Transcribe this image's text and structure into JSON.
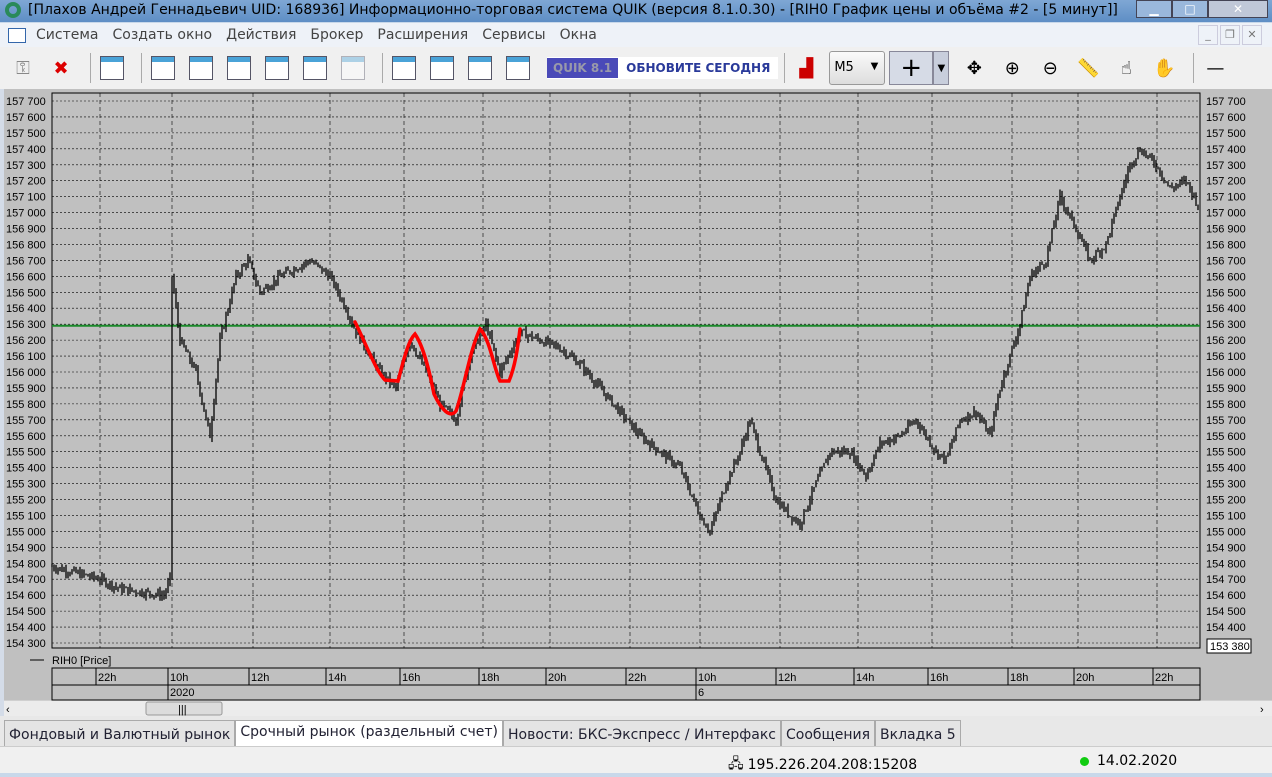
{
  "window": {
    "title": "[Плахов Андрей Геннадьевич UID: 168936] Информационно-торговая система QUIK (версия 8.1.0.30) - [RIH0 График цены и объёма #2 - [5 минут]]"
  },
  "menu": [
    "Система",
    "Создать окно",
    "Действия",
    "Брокер",
    "Расширения",
    "Сервисы",
    "Окна"
  ],
  "toolbar": {
    "quik_version": "QUIK 8.1",
    "update_banner": "ОБНОВИТЕ СЕГОДНЯ",
    "interval": "M5"
  },
  "chart": {
    "legend": "RIH0 [Price]",
    "last_value": "153 380",
    "colors": {
      "price": "#000000",
      "level": "#1a8a2a",
      "drawing": "#ff0000",
      "bg": "#c0c0c0"
    }
  },
  "chart_data": {
    "type": "line",
    "instrument": "RIH0",
    "interval": "5 минут",
    "ylim": [
      154300,
      157700
    ],
    "yticks": [
      "157 700",
      "157 600",
      "157 500",
      "157 400",
      "157 300",
      "157 200",
      "157 100",
      "157 000",
      "156 900",
      "156 800",
      "156 700",
      "156 600",
      "156 500",
      "156 400",
      "156 300",
      "156 200",
      "156 100",
      "156 000",
      "155 900",
      "155 800",
      "155 700",
      "155 600",
      "155 500",
      "155 400",
      "155 300",
      "155 200",
      "155 100",
      "155 000",
      "154 900",
      "154 800",
      "154 700",
      "154 600",
      "154 500",
      "154 400",
      "154 300"
    ],
    "xticks": [
      "22h",
      "10h",
      "12h",
      "14h",
      "16h",
      "18h",
      "20h",
      "22h",
      "10h",
      "12h",
      "14h",
      "16h",
      "18h",
      "20h",
      "22h"
    ],
    "xticks_row2": [
      "2020",
      "6"
    ],
    "level_line": 156290,
    "points": [
      [
        0,
        154780
      ],
      [
        24,
        154700
      ],
      [
        34,
        154640
      ],
      [
        56,
        154600
      ],
      [
        59,
        154700
      ],
      [
        60,
        156600
      ],
      [
        64,
        156200
      ],
      [
        72,
        156000
      ],
      [
        77,
        155700
      ],
      [
        79,
        155600
      ],
      [
        84,
        156200
      ],
      [
        92,
        156600
      ],
      [
        98,
        156700
      ],
      [
        104,
        156500
      ],
      [
        114,
        156600
      ],
      [
        129,
        156700
      ],
      [
        139,
        156600
      ],
      [
        147,
        156400
      ],
      [
        152,
        156250
      ],
      [
        164,
        156000
      ],
      [
        172,
        155900
      ],
      [
        179,
        156200
      ],
      [
        187,
        156000
      ],
      [
        194,
        155800
      ],
      [
        202,
        155700
      ],
      [
        209,
        156100
      ],
      [
        217,
        156300
      ],
      [
        224,
        156000
      ],
      [
        234,
        156250
      ],
      [
        244,
        156200
      ],
      [
        254,
        156150
      ],
      [
        264,
        156050
      ],
      [
        274,
        155900
      ],
      [
        284,
        155750
      ],
      [
        294,
        155600
      ],
      [
        304,
        155500
      ],
      [
        314,
        155400
      ],
      [
        324,
        155100
      ],
      [
        329,
        155000
      ],
      [
        337,
        155300
      ],
      [
        344,
        155500
      ],
      [
        349,
        155700
      ],
      [
        354,
        155500
      ],
      [
        362,
        155200
      ],
      [
        369,
        155100
      ],
      [
        374,
        155050
      ],
      [
        382,
        155300
      ],
      [
        389,
        155500
      ],
      [
        399,
        155500
      ],
      [
        407,
        155350
      ],
      [
        414,
        155550
      ],
      [
        424,
        155600
      ],
      [
        432,
        155700
      ],
      [
        442,
        155500
      ],
      [
        447,
        155450
      ],
      [
        454,
        155700
      ],
      [
        462,
        155750
      ],
      [
        469,
        155600
      ],
      [
        474,
        155900
      ],
      [
        479,
        156100
      ],
      [
        484,
        156300
      ],
      [
        489,
        156600
      ],
      [
        497,
        156700
      ],
      [
        504,
        157100
      ],
      [
        512,
        156900
      ],
      [
        519,
        156700
      ],
      [
        527,
        156800
      ],
      [
        534,
        157100
      ],
      [
        539,
        157300
      ],
      [
        544,
        157400
      ],
      [
        552,
        157300
      ],
      [
        559,
        157150
      ],
      [
        567,
        157200
      ],
      [
        573,
        157050
      ]
    ]
  },
  "tabs": [
    "Фондовый и Валютный рынок",
    "Срочный рынок (раздельный счет)",
    "Новости: БКС-Экспресс / Интерфакс",
    "Сообщения",
    "Вкладка 5"
  ],
  "status": {
    "connection": "195.226.204.208:15208",
    "date": "14.02.2020"
  }
}
